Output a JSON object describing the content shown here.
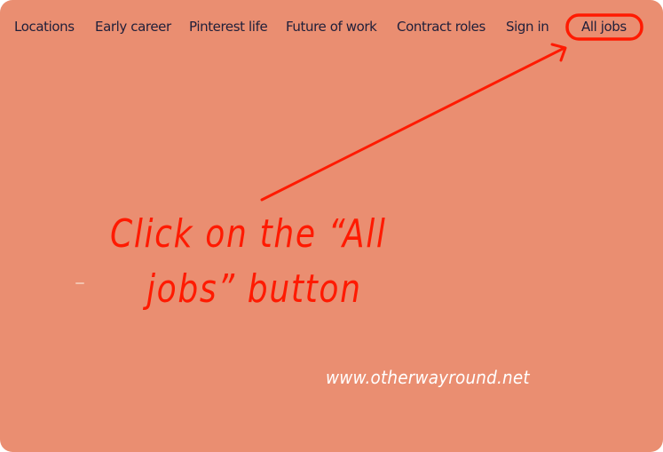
{
  "nav": {
    "items": [
      {
        "label": "Locations"
      },
      {
        "label": "Early career"
      },
      {
        "label": "Pinterest life"
      },
      {
        "label": "Future of work"
      },
      {
        "label": "Contract roles"
      },
      {
        "label": "Sign in"
      },
      {
        "label": "All jobs",
        "highlighted": true
      }
    ]
  },
  "annotation": {
    "line1": "Click on the “All",
    "line2": "jobs” button",
    "color": "#ff1a00"
  },
  "watermark": "www.otherwayround.net",
  "colors": {
    "background": "#ea8e71",
    "nav_text": "#1f1f3a",
    "highlight": "#ff1a00",
    "watermark": "#ffffff"
  }
}
